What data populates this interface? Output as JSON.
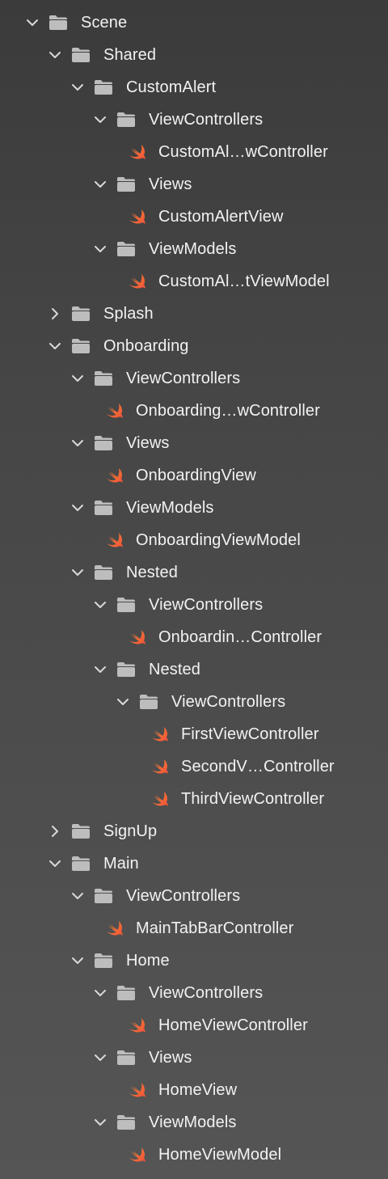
{
  "navigator": {
    "items": [
      {
        "label": "Scene",
        "depth": 0,
        "type": "folder",
        "expanded": true
      },
      {
        "label": "Shared",
        "depth": 1,
        "type": "folder",
        "expanded": true
      },
      {
        "label": "CustomAlert",
        "depth": 2,
        "type": "folder",
        "expanded": true
      },
      {
        "label": "ViewControllers",
        "depth": 3,
        "type": "folder",
        "expanded": true
      },
      {
        "label": "CustomAl…wController",
        "depth": 4,
        "type": "swift"
      },
      {
        "label": "Views",
        "depth": 3,
        "type": "folder",
        "expanded": true
      },
      {
        "label": "CustomAlertView",
        "depth": 4,
        "type": "swift"
      },
      {
        "label": "ViewModels",
        "depth": 3,
        "type": "folder",
        "expanded": true
      },
      {
        "label": "CustomAl…tViewModel",
        "depth": 4,
        "type": "swift"
      },
      {
        "label": "Splash",
        "depth": 1,
        "type": "folder",
        "expanded": false
      },
      {
        "label": "Onboarding",
        "depth": 1,
        "type": "folder",
        "expanded": true
      },
      {
        "label": "ViewControllers",
        "depth": 2,
        "type": "folder",
        "expanded": true
      },
      {
        "label": "Onboarding…wController",
        "depth": 3,
        "type": "swift"
      },
      {
        "label": "Views",
        "depth": 2,
        "type": "folder",
        "expanded": true
      },
      {
        "label": "OnboardingView",
        "depth": 3,
        "type": "swift"
      },
      {
        "label": "ViewModels",
        "depth": 2,
        "type": "folder",
        "expanded": true
      },
      {
        "label": "OnboardingViewModel",
        "depth": 3,
        "type": "swift"
      },
      {
        "label": "Nested",
        "depth": 2,
        "type": "folder",
        "expanded": true
      },
      {
        "label": "ViewControllers",
        "depth": 3,
        "type": "folder",
        "expanded": true
      },
      {
        "label": "Onboardin…Controller",
        "depth": 4,
        "type": "swift"
      },
      {
        "label": "Nested",
        "depth": 3,
        "type": "folder",
        "expanded": true
      },
      {
        "label": "ViewControllers",
        "depth": 4,
        "type": "folder",
        "expanded": true
      },
      {
        "label": "FirstViewController",
        "depth": 5,
        "type": "swift"
      },
      {
        "label": "SecondV…Controller",
        "depth": 5,
        "type": "swift"
      },
      {
        "label": "ThirdViewController",
        "depth": 5,
        "type": "swift"
      },
      {
        "label": "SignUp",
        "depth": 1,
        "type": "folder",
        "expanded": false
      },
      {
        "label": "Main",
        "depth": 1,
        "type": "folder",
        "expanded": true
      },
      {
        "label": "ViewControllers",
        "depth": 2,
        "type": "folder",
        "expanded": true
      },
      {
        "label": "MainTabBarController",
        "depth": 3,
        "type": "swift"
      },
      {
        "label": "Home",
        "depth": 2,
        "type": "folder",
        "expanded": true
      },
      {
        "label": "ViewControllers",
        "depth": 3,
        "type": "folder",
        "expanded": true
      },
      {
        "label": "HomeViewController",
        "depth": 4,
        "type": "swift"
      },
      {
        "label": "Views",
        "depth": 3,
        "type": "folder",
        "expanded": true
      },
      {
        "label": "HomeView",
        "depth": 4,
        "type": "swift"
      },
      {
        "label": "ViewModels",
        "depth": 3,
        "type": "folder",
        "expanded": true
      },
      {
        "label": "HomeViewModel",
        "depth": 4,
        "type": "swift"
      }
    ]
  },
  "colors": {
    "folder_icon": "#bdbdbd",
    "chevron": "#d9d9d9",
    "swift_orange": "#f05138",
    "swift_light": "#f88a36",
    "text": "#f2f2f2"
  },
  "icons": {
    "folder": "folder-icon",
    "swift": "swift-file-icon",
    "expanded": "chevron-down-icon",
    "collapsed": "chevron-right-icon"
  }
}
